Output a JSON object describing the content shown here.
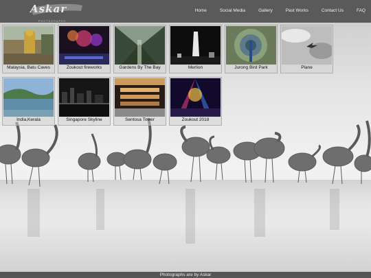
{
  "header": {
    "logo_text": "Askar",
    "logo_sub": "PHOTOGRAPHY"
  },
  "nav": {
    "items": [
      {
        "label": "Home"
      },
      {
        "label": "Social Media"
      },
      {
        "label": "Gallery"
      },
      {
        "label": "Past Works"
      },
      {
        "label": "Contact Us"
      },
      {
        "label": "FAQ"
      }
    ]
  },
  "gallery": {
    "items": [
      {
        "caption": "Malaysia, Batu Caves"
      },
      {
        "caption": "Zoukout fireworks"
      },
      {
        "caption": "Gardens By The Bay"
      },
      {
        "caption": "Merlion"
      },
      {
        "caption": "Jurong Bird Park"
      },
      {
        "caption": "Plane"
      },
      {
        "caption": "India,Kerala"
      },
      {
        "caption": "Singapore Skyline"
      },
      {
        "caption": "Sentosa Tower"
      },
      {
        "caption": "Zoukout 2018"
      }
    ]
  },
  "footer": {
    "text": "Photographs are by Askar"
  },
  "colors": {
    "header_bg": "#5a5a5a",
    "footer_bg": "#555555",
    "nav_text": "#f0f0f0"
  }
}
